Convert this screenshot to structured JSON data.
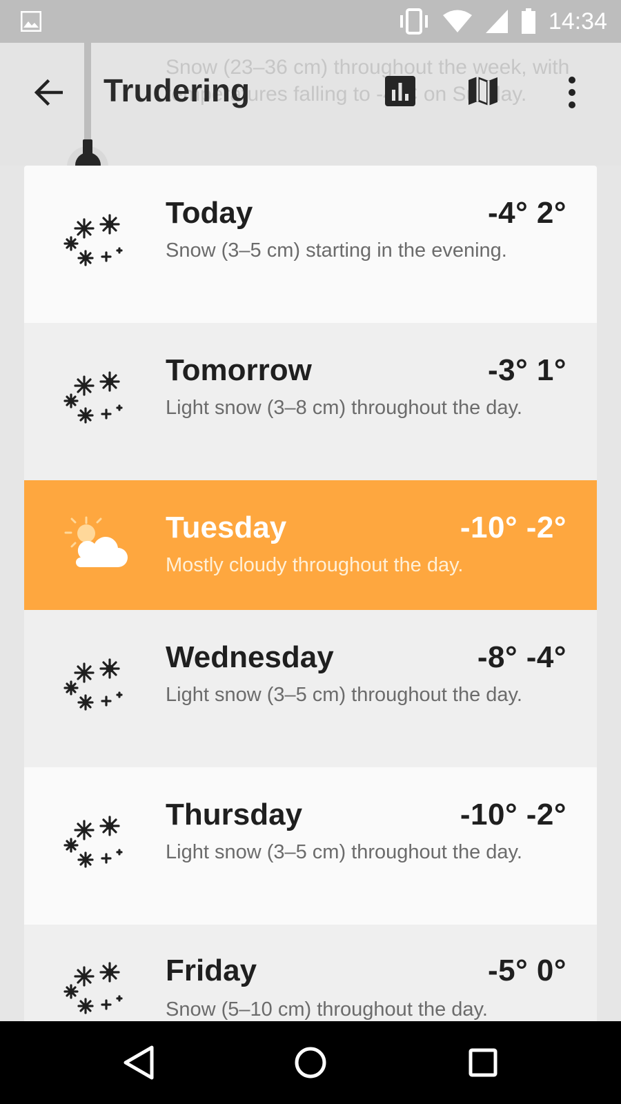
{
  "status_bar": {
    "time": "14:34",
    "icons": [
      "image-icon",
      "vibrate-icon",
      "wifi-icon",
      "signal-icon",
      "battery-icon"
    ]
  },
  "header": {
    "title": "Trudering",
    "summary_background_text": "Snow (23–36 cm) throughout the week, with temperatures falling to -4°C on Sunday.",
    "back_icon": "arrow-back-icon",
    "chart_icon": "bar-chart-icon",
    "map_icon": "map-icon",
    "more_icon": "more-vert-icon"
  },
  "forecast": [
    {
      "day": "Today",
      "low": "-4°",
      "high": "2°",
      "description": "Snow (3–5 cm) starting in the evening.",
      "icon": "snow-icon",
      "highlight": false
    },
    {
      "day": "Tomorrow",
      "low": "-3°",
      "high": "1°",
      "description": "Light snow (3–8 cm) throughout the day.",
      "icon": "snow-icon",
      "highlight": false
    },
    {
      "day": "Tuesday",
      "low": "-10°",
      "high": "-2°",
      "description": "Mostly cloudy throughout the day.",
      "icon": "partly-cloudy-icon",
      "highlight": true
    },
    {
      "day": "Wednesday",
      "low": "-8°",
      "high": "-4°",
      "description": "Light snow (3–5 cm) throughout the day.",
      "icon": "snow-icon",
      "highlight": false
    },
    {
      "day": "Thursday",
      "low": "-10°",
      "high": "-2°",
      "description": "Light snow (3–5 cm) throughout the day.",
      "icon": "snow-icon",
      "highlight": false
    },
    {
      "day": "Friday",
      "low": "-5°",
      "high": "0°",
      "description": "Snow (5–10 cm) throughout the day.",
      "icon": "snow-icon",
      "highlight": false
    }
  ],
  "colors": {
    "highlight": "#fea73f",
    "status_bar": "#bdbdbd",
    "nav_bar": "#000000"
  },
  "nav_bar": {
    "icons": [
      "back-triangle-icon",
      "home-circle-icon",
      "recents-square-icon"
    ]
  }
}
